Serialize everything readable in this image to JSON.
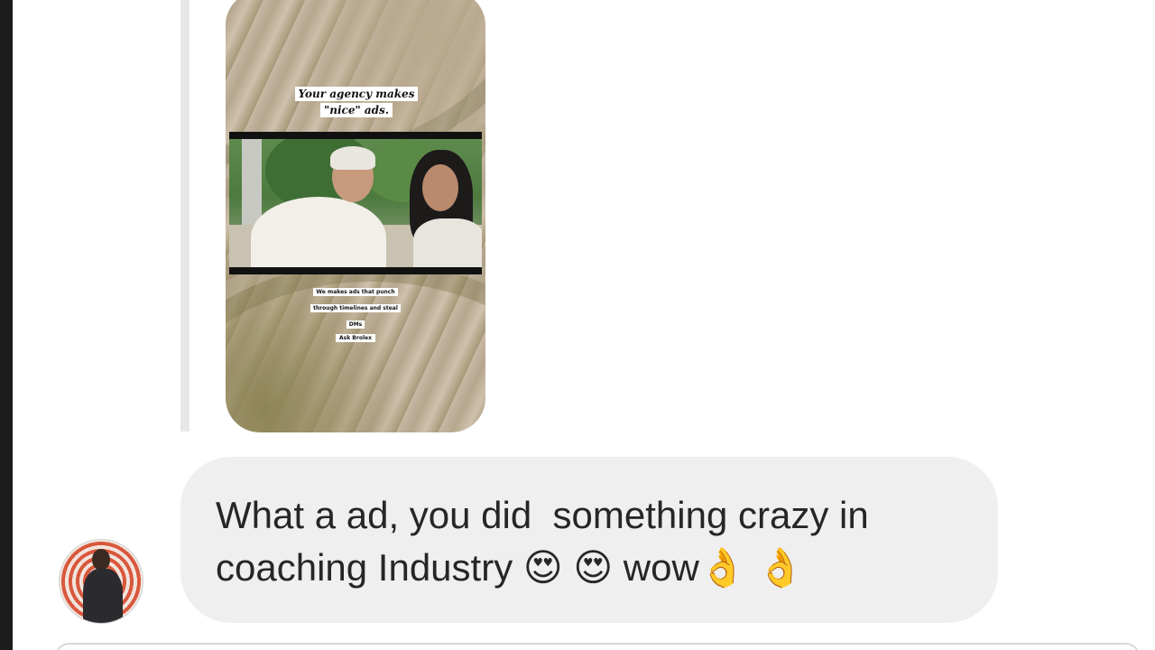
{
  "thread": {
    "shared_story": {
      "caption_top": "Your agency makes \"nice\" ads.",
      "caption_bottom": "We makes ads that punch through timelines and steal DMs",
      "caption_signature": "Ask Brolex"
    },
    "message": {
      "text_line1": "What a ad, you did  something crazy in",
      "text_line2_start": "coaching Industry ",
      "emoji_1": "😍",
      "emoji_2": "😍",
      "text_word": " wow",
      "emoji_3": "👌",
      "emoji_4": "👌"
    },
    "sender_avatar": {
      "icon": "profile-photo"
    }
  },
  "colors": {
    "bubble_bg": "#efefef",
    "text": "#262626",
    "avatar_ring": "#d9583d"
  }
}
